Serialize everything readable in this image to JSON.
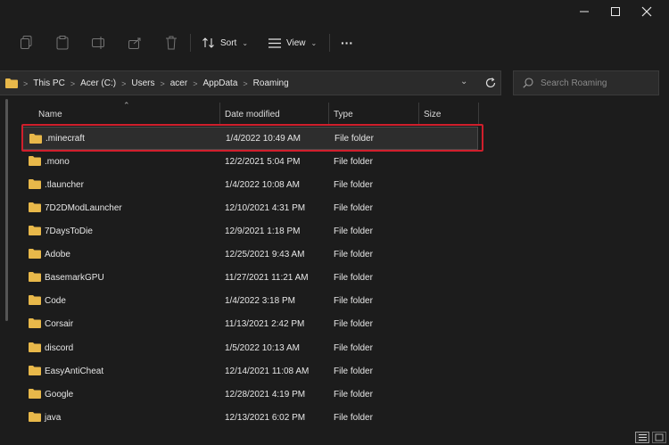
{
  "window": {
    "minimize_icon": "minimize-icon",
    "maximize_icon": "maximize-icon",
    "close_icon": "close-icon"
  },
  "toolbar": {
    "sort_label": "Sort",
    "view_label": "View",
    "more_label": "···",
    "icons": [
      "copy-icon",
      "paste-icon",
      "rename-icon",
      "share-icon",
      "delete-icon"
    ]
  },
  "address": {
    "breadcrumbs": [
      "This PC",
      "Acer (C:)",
      "Users",
      "acer",
      "AppData",
      "Roaming"
    ]
  },
  "search": {
    "placeholder": "Search Roaming"
  },
  "columns": {
    "name": "Name",
    "date": "Date modified",
    "type": "Type",
    "size": "Size"
  },
  "files": [
    {
      "name": ".minecraft",
      "date": "1/4/2022 10:49 AM",
      "type": "File folder"
    },
    {
      "name": ".mono",
      "date": "12/2/2021 5:04 PM",
      "type": "File folder"
    },
    {
      "name": ".tlauncher",
      "date": "1/4/2022 10:08 AM",
      "type": "File folder"
    },
    {
      "name": "7D2DModLauncher",
      "date": "12/10/2021 4:31 PM",
      "type": "File folder"
    },
    {
      "name": "7DaysToDie",
      "date": "12/9/2021 1:18 PM",
      "type": "File folder"
    },
    {
      "name": "Adobe",
      "date": "12/25/2021 9:43 AM",
      "type": "File folder"
    },
    {
      "name": "BasemarkGPU",
      "date": "11/27/2021 11:21 AM",
      "type": "File folder"
    },
    {
      "name": "Code",
      "date": "1/4/2022 3:18 PM",
      "type": "File folder"
    },
    {
      "name": "Corsair",
      "date": "11/13/2021 2:42 PM",
      "type": "File folder"
    },
    {
      "name": "discord",
      "date": "1/5/2022 10:13 AM",
      "type": "File folder"
    },
    {
      "name": "EasyAntiCheat",
      "date": "12/14/2021 11:08 AM",
      "type": "File folder"
    },
    {
      "name": "Google",
      "date": "12/28/2021 4:19 PM",
      "type": "File folder"
    },
    {
      "name": "java",
      "date": "12/13/2021 6:02 PM",
      "type": "File folder"
    }
  ],
  "colors": {
    "background": "#1c1c1c",
    "folder": "#e8b84a",
    "highlight": "#d01f2c"
  }
}
